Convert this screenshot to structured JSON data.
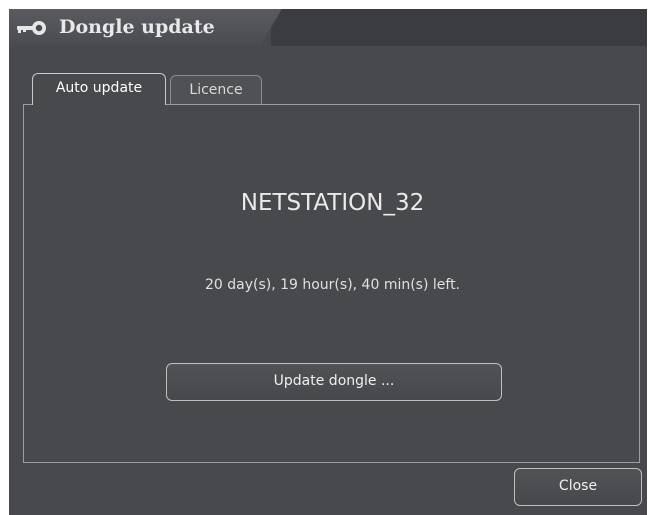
{
  "window": {
    "title": "Dongle update",
    "title_icon": "key-icon"
  },
  "tabs": [
    {
      "label": "Auto update",
      "active": true
    },
    {
      "label": "Licence",
      "active": false
    }
  ],
  "auto_update": {
    "device_name": "NETSTATION_32",
    "time_left": "20 day(s), 19 hour(s), 40 min(s) left.",
    "update_button_label": "Update dongle ..."
  },
  "footer": {
    "close_label": "Close"
  },
  "colors": {
    "background": "#48494d",
    "title_bar": "#3b3c40",
    "border": "#9c9da0",
    "text": "#e6e6e6"
  }
}
